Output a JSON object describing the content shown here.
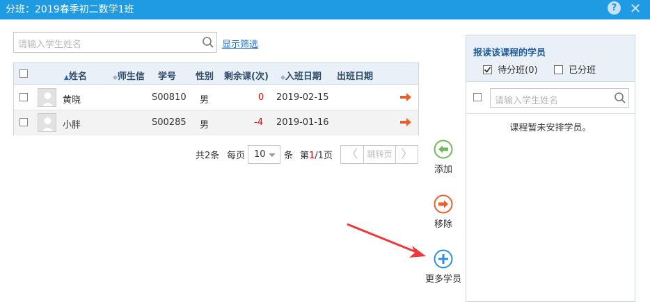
{
  "window": {
    "title": "分班：2019春季初二数学1班",
    "help_label": "?",
    "close_label": "✕"
  },
  "search": {
    "placeholder": "请输入学生姓名"
  },
  "filter_link": "显示筛选",
  "table": {
    "headers": [
      "姓名",
      "师生信",
      "学号",
      "性别",
      "剩余课(次)",
      "入班日期",
      "出班日期"
    ],
    "rows": [
      {
        "name": "黄晓",
        "student_id": "S00810",
        "gender": "男",
        "remaining": "0",
        "join_date": "2019-02-15",
        "leave_date": ""
      },
      {
        "name": "小胖",
        "student_id": "S00285",
        "gender": "男",
        "remaining": "-4",
        "join_date": "2019-01-16",
        "leave_date": ""
      }
    ]
  },
  "pager": {
    "total": "共2条",
    "per_page_label": "每页",
    "per_page_value": "10",
    "unit": "条",
    "page_prefix": "第",
    "page_current": "1",
    "page_suffix": "/1页",
    "jump_label": "跳转页",
    "prev": "〈",
    "next": "〉"
  },
  "actions": {
    "add": "添加",
    "remove": "移除",
    "more": "更多学员"
  },
  "right_panel": {
    "title": "报读该课程的学员",
    "pending_label": "待分班(0)",
    "assigned_label": "已分班",
    "search_placeholder": "请输入学生姓名",
    "empty_text": "课程暂未安排学员。"
  },
  "colors": {
    "titlebar": "#1e9be3",
    "add": "#6fb85b",
    "remove": "#e3612f",
    "more": "#2f8fd6",
    "annotation": "#f0373c"
  }
}
